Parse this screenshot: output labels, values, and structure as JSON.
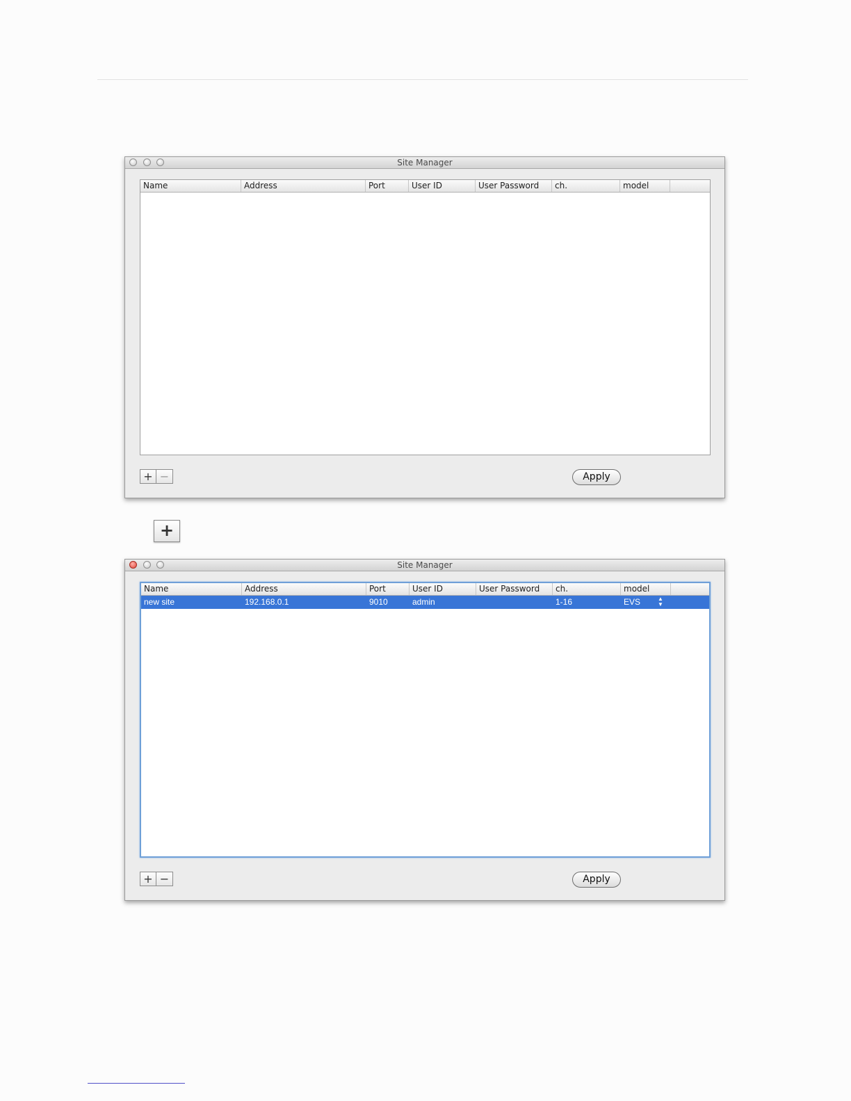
{
  "columns": [
    "Name",
    "Address",
    "Port",
    "User ID",
    "User Password",
    "ch.",
    "model"
  ],
  "window1": {
    "title": "Site Manager",
    "add_label": "+",
    "remove_label": "−",
    "apply_label": "Apply"
  },
  "standalone_add_label": "+",
  "window2": {
    "title": "Site Manager",
    "add_label": "+",
    "remove_label": "−",
    "apply_label": "Apply",
    "row": {
      "name": "new site",
      "address": "192.168.0.1",
      "port": "9010",
      "user_id": "admin",
      "user_password": "",
      "ch": "1-16",
      "model": "EVS"
    },
    "selection_color": "#3875d7"
  }
}
